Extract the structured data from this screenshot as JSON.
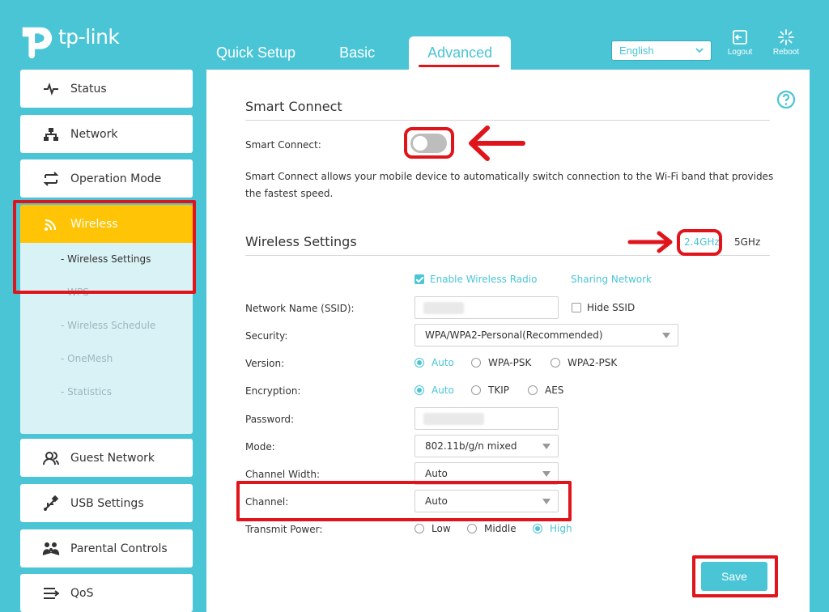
{
  "brand": {
    "logo_text": "tp-link"
  },
  "header": {
    "tabs": [
      {
        "label": "Quick Setup"
      },
      {
        "label": "Basic"
      },
      {
        "label": "Advanced",
        "active": true
      }
    ],
    "language": {
      "selected": "English"
    },
    "logout_label": "Logout",
    "reboot_label": "Reboot"
  },
  "sidebar": {
    "items": [
      {
        "label": "Status",
        "icon": "pulse-icon"
      },
      {
        "label": "Network",
        "icon": "network-icon"
      },
      {
        "label": "Operation Mode",
        "icon": "swap-icon"
      },
      {
        "label": "Wireless",
        "icon": "wifi-icon",
        "active": true
      },
      {
        "label": "Guest Network",
        "icon": "users-icon"
      },
      {
        "label": "USB Settings",
        "icon": "usb-icon"
      },
      {
        "label": "Parental Controls",
        "icon": "family-icon"
      },
      {
        "label": "QoS",
        "icon": "qos-icon"
      }
    ],
    "wireless_submenu": [
      {
        "label": "- Wireless Settings",
        "active": true
      },
      {
        "label": "- WPS"
      },
      {
        "label": "- Wireless Schedule"
      },
      {
        "label": "- OneMesh"
      },
      {
        "label": "- Statistics"
      }
    ]
  },
  "smart_connect": {
    "title": "Smart Connect",
    "label": "Smart Connect:",
    "enabled": false,
    "description": "Smart Connect allows your mobile device to automatically switch connection to the Wi-Fi band that provides the fastest speed."
  },
  "wireless_settings": {
    "title": "Wireless Settings",
    "bands": {
      "band_24": "2.4GHz",
      "band_5": "5GHz",
      "selected": "2.4GHz"
    },
    "enable_radio_label": "Enable Wireless Radio",
    "sharing_network_label": "Sharing Network",
    "ssid_label": "Network Name (SSID):",
    "hide_ssid_label": "Hide SSID",
    "security_label": "Security:",
    "security_value": "WPA/WPA2-Personal(Recommended)",
    "version_label": "Version:",
    "version_options": [
      "Auto",
      "WPA-PSK",
      "WPA2-PSK"
    ],
    "version_selected": "Auto",
    "encryption_label": "Encryption:",
    "encryption_options": [
      "Auto",
      "TKIP",
      "AES"
    ],
    "encryption_selected": "Auto",
    "password_label": "Password:",
    "mode_label": "Mode:",
    "mode_value": "802.11b/g/n mixed",
    "channel_width_label": "Channel Width:",
    "channel_width_value": "Auto",
    "channel_label": "Channel:",
    "channel_value": "Auto",
    "transmit_power_label": "Transmit Power:",
    "power_options": [
      "Low",
      "Middle",
      "High"
    ],
    "power_selected": "High"
  },
  "save_label": "Save",
  "colors": {
    "brand": "#4ac5d6",
    "highlight": "#e0141b",
    "active_menu": "#ffc405"
  }
}
